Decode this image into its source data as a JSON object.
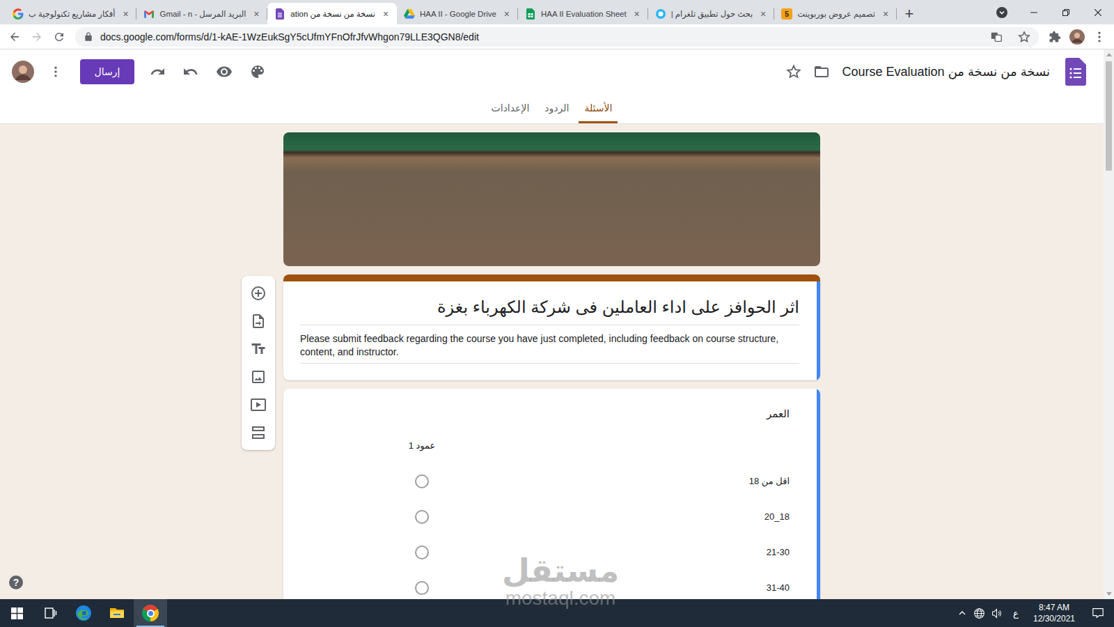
{
  "browser": {
    "tabs": [
      {
        "label": "أفكار مشاريع تكنولوجية ب",
        "kind": "google",
        "selected": false
      },
      {
        "label": "البريد المرسل - Gmail - n",
        "kind": "gmail",
        "selected": false
      },
      {
        "label": "نسخة من نسخة من ation",
        "kind": "forms",
        "selected": true
      },
      {
        "label": "HAA II - Google Drive",
        "kind": "drive",
        "selected": false
      },
      {
        "label": "HAA II Evaluation Sheet",
        "kind": "sheets",
        "selected": false
      },
      {
        "label": "بحث حول تطبيق تلغرام |",
        "kind": "circle",
        "selected": false
      },
      {
        "label": "تصميم عروض بوربوينت",
        "kind": "badge",
        "icon_text": "5",
        "selected": false
      }
    ],
    "close_glyph": "×",
    "new_tab": "+",
    "url": "docs.google.com/forms/d/1-kAE-1WzEukSgY5cUfmYFnOfrJfvWhgon79LLE3QGN8/edit"
  },
  "form_header": {
    "title": "نسخة من نسخة من Course Evaluation",
    "send": "إرسال",
    "tabs": [
      {
        "label": "الأسئلة",
        "selected": true
      },
      {
        "label": "الردود",
        "selected": false
      },
      {
        "label": "الإعدادات",
        "selected": false
      }
    ]
  },
  "form": {
    "title": "اثر الحوافز على اداء العاملين فى شركة الكهرباء بغزة",
    "description": "Please submit feedback regarding the course you have just completed, including feedback on course structure, content, and instructor."
  },
  "question": {
    "title": "العمر",
    "columns": [
      "عمود 1"
    ],
    "rows": [
      {
        "label": "اقل من 18",
        "selected": false
      },
      {
        "label": "20_18",
        "selected": false
      },
      {
        "label": "21-30",
        "selected": false
      },
      {
        "label": "31-40",
        "selected": false
      }
    ]
  },
  "help": "?",
  "watermark": {
    "text": "مستقل",
    "site": "mostaql.com"
  },
  "taskbar": {
    "apps": [
      {
        "kind": "windows",
        "selected": false
      },
      {
        "kind": "taskview",
        "selected": false
      },
      {
        "kind": "edge",
        "selected": false
      },
      {
        "kind": "explorer",
        "selected": false
      },
      {
        "kind": "chrome",
        "selected": true
      }
    ],
    "language": "ع",
    "time": "8:47 AM",
    "date": "12/30/2021"
  }
}
